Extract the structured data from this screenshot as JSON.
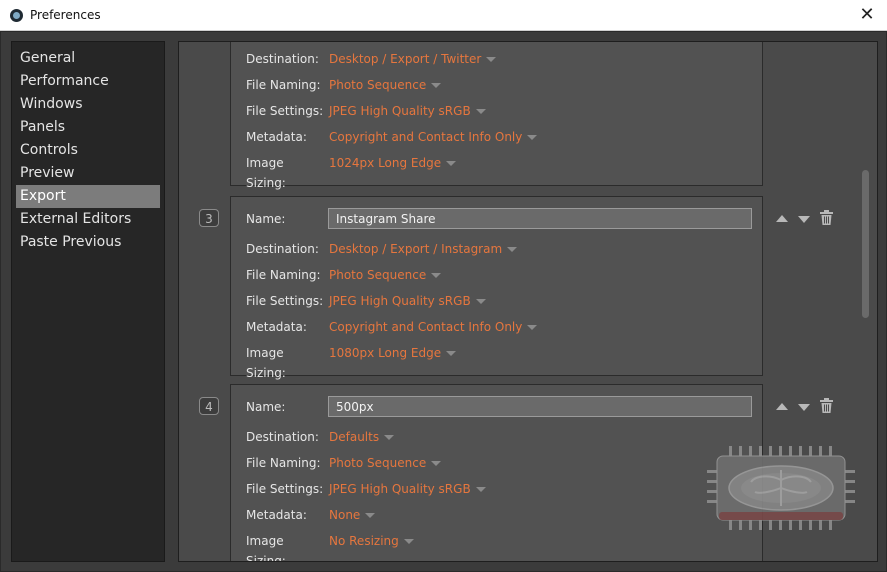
{
  "window": {
    "title": "Preferences"
  },
  "sidebar": {
    "items": [
      {
        "label": "General",
        "selected": false
      },
      {
        "label": "Performance",
        "selected": false
      },
      {
        "label": "Windows",
        "selected": false
      },
      {
        "label": "Panels",
        "selected": false
      },
      {
        "label": "Controls",
        "selected": false
      },
      {
        "label": "Preview",
        "selected": false
      },
      {
        "label": "Export",
        "selected": true
      },
      {
        "label": "External Editors",
        "selected": false
      },
      {
        "label": "Paste Previous",
        "selected": false
      }
    ]
  },
  "labels": {
    "name": "Name:",
    "destination": "Destination:",
    "file_naming": "File Naming:",
    "file_settings": "File Settings:",
    "metadata": "Metadata:",
    "image_sizing": "Image Sizing:"
  },
  "presets": [
    {
      "destination": "Desktop / Export / Twitter",
      "file_naming": "Photo Sequence",
      "file_settings": "JPEG High Quality sRGB",
      "metadata": "Copyright and Contact Info Only",
      "image_sizing": "1024px Long Edge"
    },
    {
      "number": "3",
      "name": "Instagram Share",
      "destination": "Desktop / Export / Instagram",
      "file_naming": "Photo Sequence",
      "file_settings": "JPEG High Quality sRGB",
      "metadata": "Copyright and Contact Info Only",
      "image_sizing": "1080px Long Edge"
    },
    {
      "number": "4",
      "name": "500px",
      "destination": "Defaults",
      "file_naming": "Photo Sequence",
      "file_settings": "JPEG High Quality sRGB",
      "metadata": "None",
      "image_sizing": "No Resizing"
    }
  ],
  "colors": {
    "accent_value": "#e6763e",
    "sidebar_selected": "#7c7c7c",
    "panel_bg": "#4a4a4a",
    "card_bg": "#525252"
  },
  "icons": {
    "app": "app-logo-icon",
    "close": "close-icon",
    "move_up": "up-arrow-icon",
    "move_down": "down-arrow-icon",
    "delete": "trash-icon",
    "dropdown": "caret-down-icon",
    "watermark": "chip-logo"
  }
}
